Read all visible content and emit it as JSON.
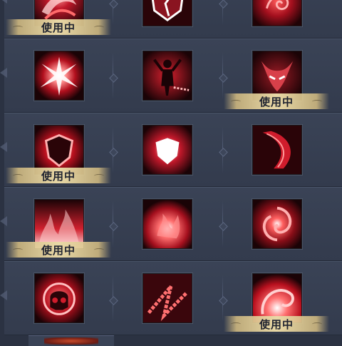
{
  "badge_label": "使用中",
  "colors": {
    "panel": "#3a4356",
    "background": "#2b3242",
    "badge": "#e8d8a6",
    "icon_red": "#c0182a",
    "icon_dark": "#1a0306"
  },
  "rows": [
    {
      "skills": [
        {
          "icon": "swirling-flame-icon",
          "in_use": true
        },
        {
          "icon": "cracked-shield-icon",
          "in_use": false
        },
        {
          "icon": "fire-orb-icon",
          "in_use": false
        }
      ]
    },
    {
      "skills": [
        {
          "icon": "burst-flash-icon",
          "in_use": false
        },
        {
          "icon": "chained-figure-icon",
          "in_use": false
        },
        {
          "icon": "demon-mask-icon",
          "in_use": true
        }
      ]
    },
    {
      "skills": [
        {
          "icon": "flaming-shield-icon",
          "in_use": true
        },
        {
          "icon": "radiant-shield-icon",
          "in_use": false
        },
        {
          "icon": "crimson-slash-icon",
          "in_use": false
        }
      ]
    },
    {
      "skills": [
        {
          "icon": "rising-flames-icon",
          "in_use": true
        },
        {
          "icon": "fire-burst-icon",
          "in_use": false
        },
        {
          "icon": "fire-vortex-icon",
          "in_use": false
        }
      ]
    },
    {
      "skills": [
        {
          "icon": "fiery-skull-icon",
          "in_use": false
        },
        {
          "icon": "chain-lash-icon",
          "in_use": false
        },
        {
          "icon": "flame-spiral-icon",
          "in_use": true
        }
      ]
    }
  ]
}
